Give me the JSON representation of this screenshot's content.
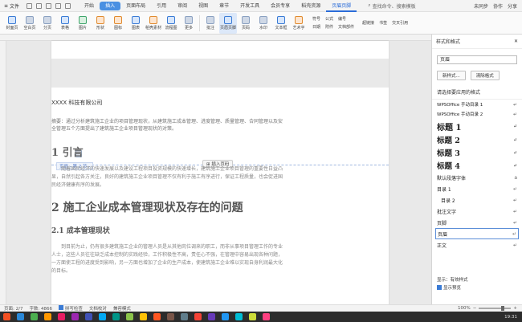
{
  "menubar": {
    "file_label": "文件",
    "tabs": [
      "开始",
      "插入",
      "页面布局",
      "引用",
      "审阅",
      "视图",
      "章节",
      "开发工具",
      "会员专享",
      "稻壳资源",
      "页眉页脚"
    ],
    "active_tab": "插入",
    "search_placeholder": "查找命令、搜索模板",
    "unsynced": "未同步",
    "collab": "协作",
    "share": "分享"
  },
  "ribbon": {
    "buttons": [
      {
        "label": "封面页",
        "tone": "blue"
      },
      {
        "label": "空白页",
        "tone": ""
      },
      {
        "label": "分页",
        "tone": ""
      },
      {
        "label": "表格",
        "tone": "blue"
      },
      {
        "label": "图片",
        "tone": "green"
      },
      {
        "label": "形状",
        "tone": "orange"
      },
      {
        "label": "图标",
        "tone": "orange"
      },
      {
        "label": "图表",
        "tone": "blue"
      },
      {
        "label": "稻壳素材",
        "tone": "orange"
      },
      {
        "label": "流程图",
        "tone": "blue"
      },
      {
        "label": "更多",
        "tone": ""
      },
      {
        "label": "批注",
        "tone": ""
      },
      {
        "label": "页眉页脚",
        "tone": "blue"
      },
      {
        "label": "页码",
        "tone": ""
      },
      {
        "label": "水印",
        "tone": ""
      },
      {
        "label": "文本框",
        "tone": "blue"
      },
      {
        "label": "艺术字",
        "tone": "orange"
      }
    ],
    "selected_button": "页眉页脚",
    "right_row1": [
      "符号",
      "公式",
      "编号"
    ],
    "right_row2": [
      "日期",
      "附件",
      "文档部件"
    ],
    "far_right": [
      "超链接",
      "书签",
      "交叉引用"
    ]
  },
  "document": {
    "header_text": "XXXX 科技有限公司",
    "header_label": "页眉 - 第 2 节 -",
    "insert_page_number": "插入页码",
    "abstract": "摘要：通过分析建筑施工企业的项目管理现状，从建筑施工成本管理、进度管理、质量管理、合同管理以及安全管理五个方面提出了建筑施工企业项目管理现状的对策。",
    "h1_intro": "1 引言",
    "para1": "随着国民经济的快速发展以及建设工程项目投资规模的快速增长，建筑施工企业项目管理的重要性日益凸显，自然引起各方关注，良好的建筑施工企业项目管理不仅有利于施工有序进行，保证工程质量，也会促进国民经济健康有序的发展。",
    "h1_second": "2 施工企业成本管理现状及存在的问题",
    "h2_first": "2.1 成本管理现状",
    "para2": "到目前为止，仍有很多建筑施工企业的管理人员是从其他岗位调来的职工，而非从事项目管理工作的专业人士，这些人员往往缺乏成本控制的实践经验，工作积极性不高，责任心不强，在管理中容易出现各种问题，一方面使工程的进度受到影响，另一方面也增加了企业的生产成本，使建筑施工企业难以实现自身利润最大化的目标。"
  },
  "panel": {
    "title": "样式和格式",
    "current_style": "页眉",
    "new_style": "新样式...",
    "clear_format": "清除格式",
    "subtitle": "请选择要应用的格式",
    "styles": [
      {
        "label": "WPSOffice 手动目录 1",
        "cls": "s-small",
        "mark": "↵"
      },
      {
        "label": "WPSOffice 手动目录 2",
        "cls": "s-small",
        "mark": "↵"
      },
      {
        "label": "标题 1",
        "cls": "s-h1",
        "mark": "↵"
      },
      {
        "label": "标题 2",
        "cls": "s-h2",
        "mark": "↵"
      },
      {
        "label": "标题 3",
        "cls": "s-h2",
        "mark": "↵"
      },
      {
        "label": "标题 4",
        "cls": "s-h2",
        "mark": "↵"
      },
      {
        "label": "默认段落字体",
        "cls": "s-mid",
        "mark": "a"
      },
      {
        "label": "目录 1",
        "cls": "s-mid",
        "mark": "↵"
      },
      {
        "label": "目录 2",
        "cls": "s-mid s-indent",
        "mark": "↵"
      },
      {
        "label": "批注文字",
        "cls": "s-mid",
        "mark": "↵"
      },
      {
        "label": "页脚",
        "cls": "s-mid",
        "mark": "↵"
      },
      {
        "label": "页眉",
        "cls": "s-mid",
        "mark": "↵"
      },
      {
        "label": "正文",
        "cls": "s-mid",
        "mark": "↵"
      }
    ],
    "selected_style": "页眉",
    "show_label": "显示：有效样式",
    "preview_label": "显示预览"
  },
  "statusbar": {
    "page": "页面: 2/7",
    "words": "字数: 4866",
    "spellcheck": "拼写检查",
    "doc_check": "文档校对",
    "compat": "兼容模式",
    "zoom": "100%"
  },
  "taskbar": {
    "clock": "19:31",
    "icon_colors": [
      "#f25022",
      "#2b88d8",
      "#4caf50",
      "#ff9800",
      "#e91e63",
      "#9c27b0",
      "#3f51b5",
      "#03a9f4",
      "#009688",
      "#8bc34a",
      "#ffc107",
      "#ff5722",
      "#795548",
      "#607d8b",
      "#f44336",
      "#673ab7",
      "#2196f3",
      "#00bcd4",
      "#cddc39",
      "#ff4081"
    ]
  }
}
